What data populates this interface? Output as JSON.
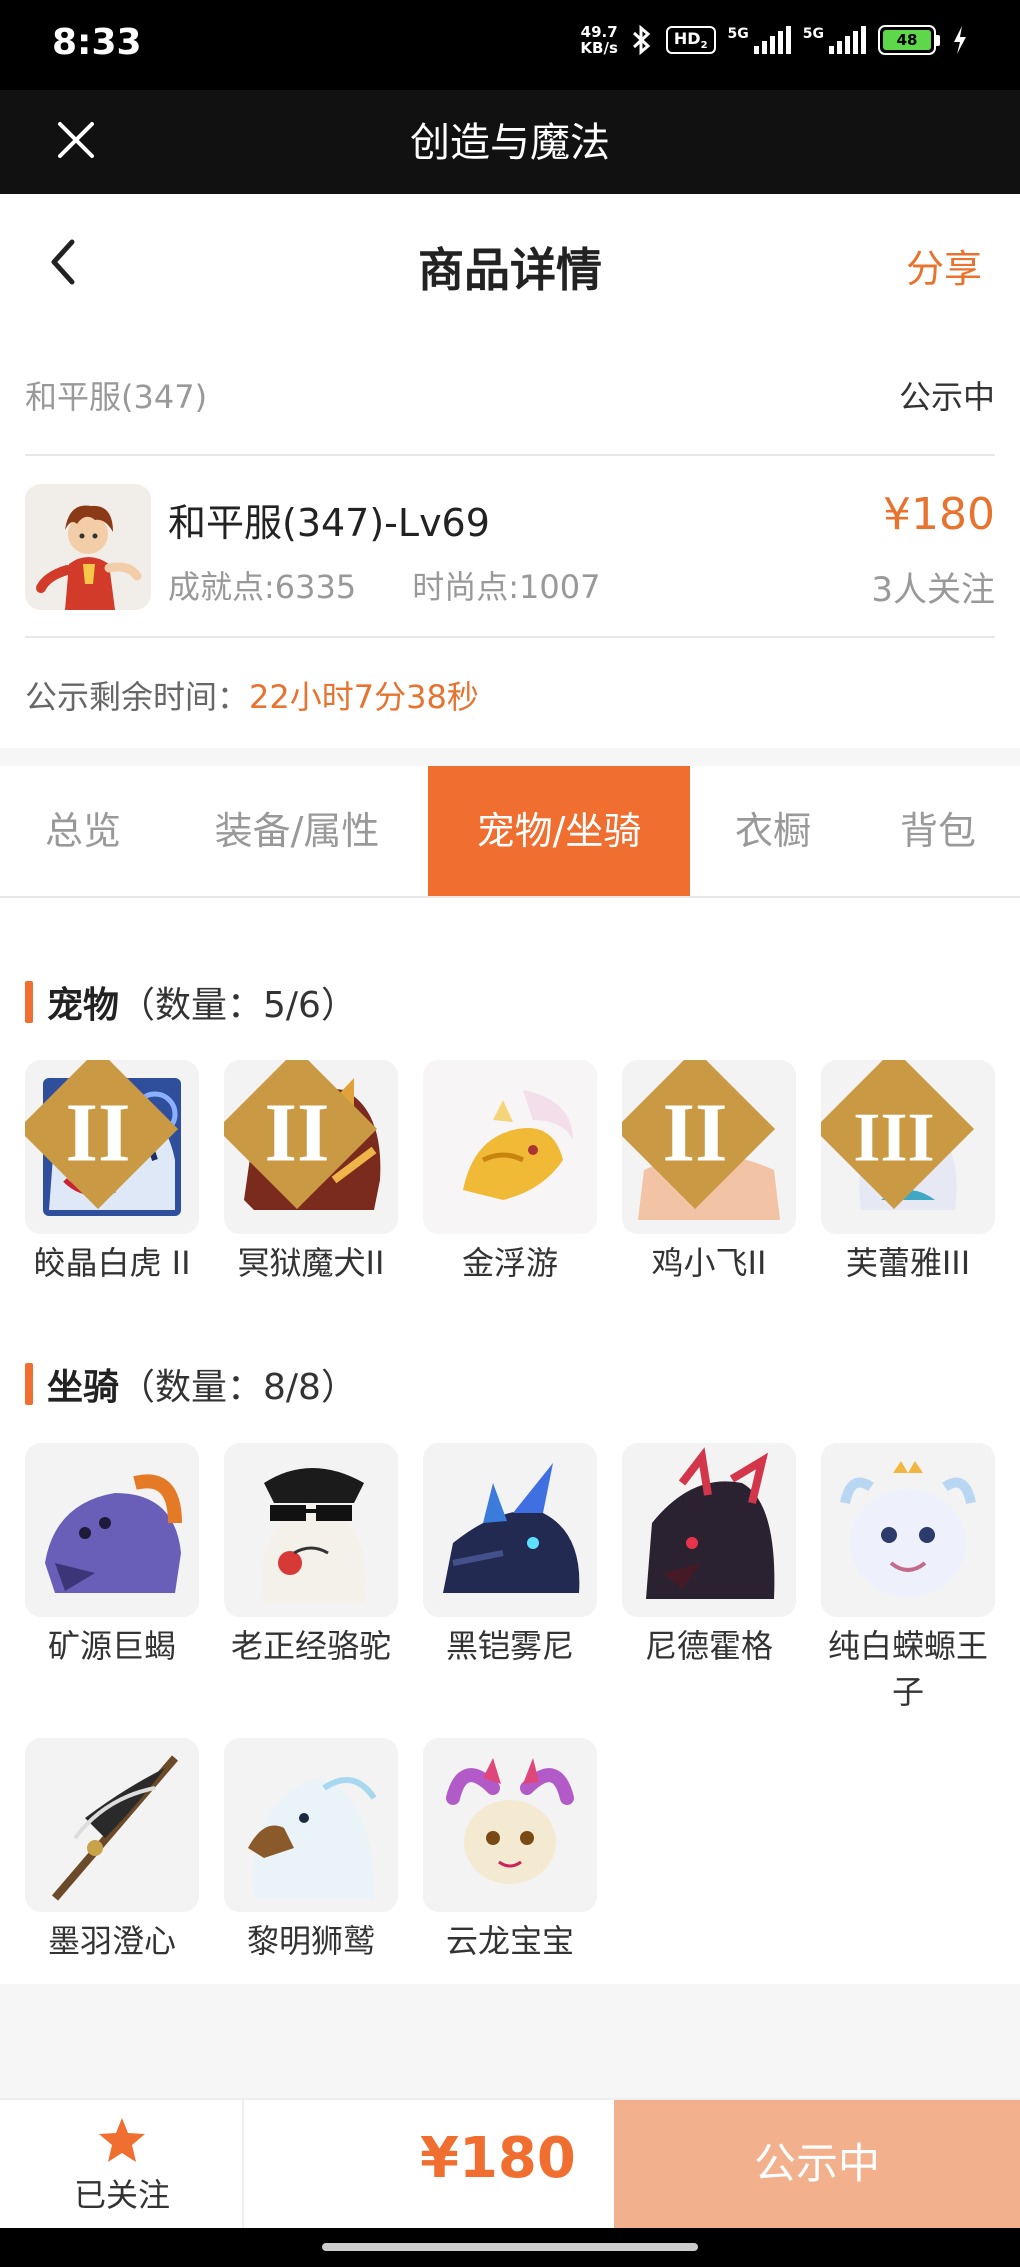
{
  "status_bar": {
    "time": "8:33",
    "net_speed_value": "49.7",
    "net_speed_unit": "KB/s",
    "hd_label": "HD",
    "hd_sub": "2",
    "signal1_label": "5G",
    "signal2_label": "5G",
    "battery": "48"
  },
  "app_bar": {
    "title": "创造与魔法"
  },
  "nav": {
    "title": "商品详情",
    "share": "分享"
  },
  "listing": {
    "server": "和平服(347)",
    "status": "公示中",
    "title": "和平服(347)-Lv69",
    "achievement": "成就点:6335",
    "fashion": "时尚点:1007",
    "price": "¥180",
    "followers": "3人关注",
    "countdown_label": "公示剩余时间：",
    "countdown_value": "22小时7分38秒"
  },
  "tabs": [
    {
      "label": "总览"
    },
    {
      "label": "装备/属性"
    },
    {
      "label": "宠物/坐骑"
    },
    {
      "label": "衣橱"
    },
    {
      "label": "背包"
    }
  ],
  "active_tab": 2,
  "pets": {
    "title": "宠物",
    "count": "（数量：5/6）",
    "items": [
      {
        "name": "皎晶白虎 II",
        "icon": "white-tiger-icon"
      },
      {
        "name": "冥狱魔犬II",
        "icon": "hell-hound-icon"
      },
      {
        "name": "金浮游",
        "icon": "golden-dragon-icon"
      },
      {
        "name": "鸡小飞II",
        "icon": "chick-icon"
      },
      {
        "name": "芙蕾雅III",
        "icon": "valkyrie-icon"
      }
    ]
  },
  "mounts": {
    "title": "坐骑",
    "count": "（数量：8/8）",
    "items": [
      {
        "name": "矿源巨蝎",
        "icon": "scorpion-icon"
      },
      {
        "name": "老正经骆驼",
        "icon": "camel-icon"
      },
      {
        "name": "黑铠雾尼",
        "icon": "black-dragon-icon"
      },
      {
        "name": "尼德霍格",
        "icon": "nidhogg-icon"
      },
      {
        "name": "纯白蝾螈王子",
        "icon": "axolotl-icon"
      },
      {
        "name": "墨羽澄心",
        "icon": "sword-icon"
      },
      {
        "name": "黎明狮鹫",
        "icon": "griffin-icon"
      },
      {
        "name": "云龙宝宝",
        "icon": "baby-dragon-icon"
      }
    ]
  },
  "bottom": {
    "follow_label": "已关注",
    "price": "¥180",
    "action": "公示中"
  },
  "colors": {
    "accent": "#ef6e30",
    "price": "#e8732f",
    "action_disabled": "#f3b08c"
  }
}
